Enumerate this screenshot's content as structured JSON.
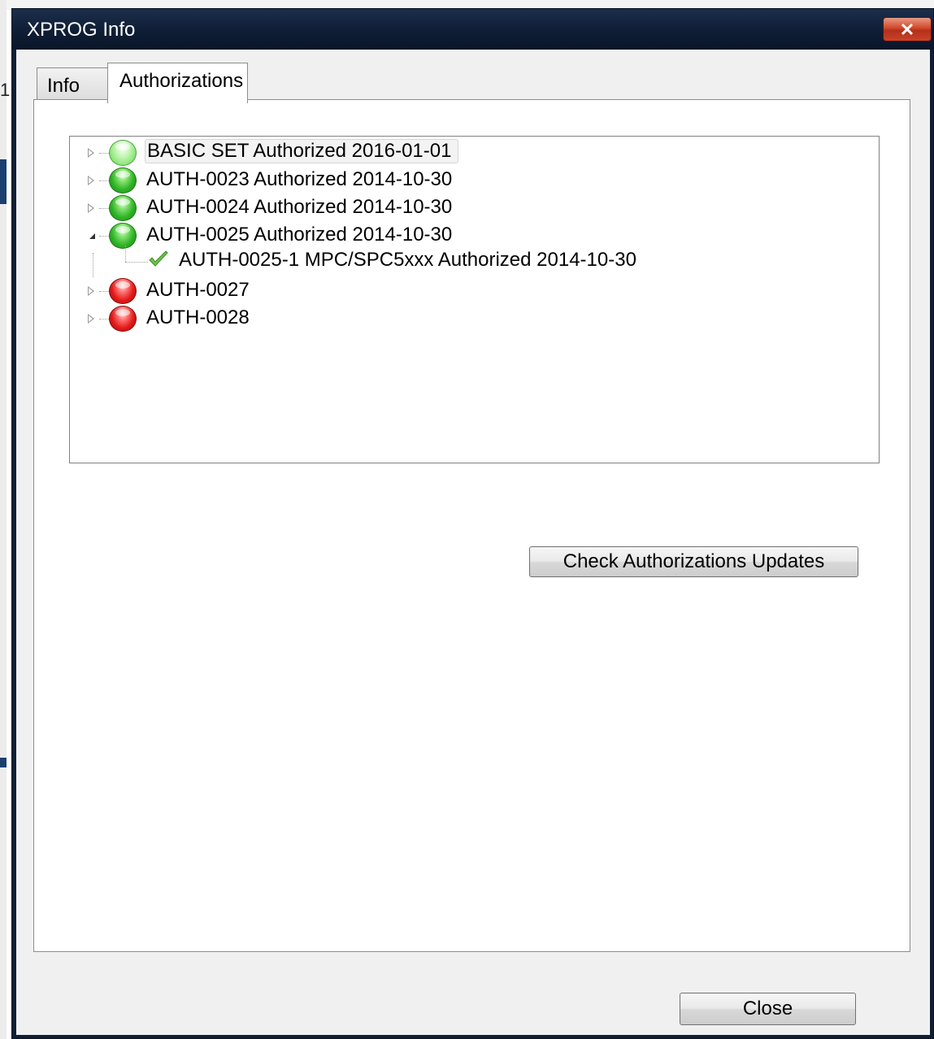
{
  "window": {
    "title": "XPROG Info",
    "close_glyph": "✕"
  },
  "background": {
    "left_edge_text": "1"
  },
  "tabs": [
    {
      "label": "Info",
      "active": false
    },
    {
      "label": "Authorizations",
      "active": true
    }
  ],
  "tree": {
    "items": [
      {
        "label": "BASIC SET Authorized 2016-01-01",
        "status": "green",
        "expanded": false,
        "selected": true
      },
      {
        "label": "AUTH-0023 Authorized 2014-10-30",
        "status": "green",
        "expanded": false
      },
      {
        "label": "AUTH-0024 Authorized 2014-10-30",
        "status": "green",
        "expanded": false
      },
      {
        "label": "AUTH-0025 Authorized 2014-10-30",
        "status": "green",
        "expanded": true
      },
      {
        "label": "AUTH-0027",
        "status": "red",
        "expanded": false
      },
      {
        "label": "AUTH-0028",
        "status": "red",
        "expanded": false
      }
    ],
    "child": {
      "label": "AUTH-0025-1 MPC/SPC5xxx Authorized 2014-10-30",
      "icon": "check-icon"
    }
  },
  "buttons": {
    "check_updates": "Check Authorizations Updates",
    "close": "Close"
  },
  "colors": {
    "title_bar": "#0e1c33",
    "status_green": "#2fb327",
    "status_red": "#e21a1a",
    "check_green": "#6cc24a"
  }
}
